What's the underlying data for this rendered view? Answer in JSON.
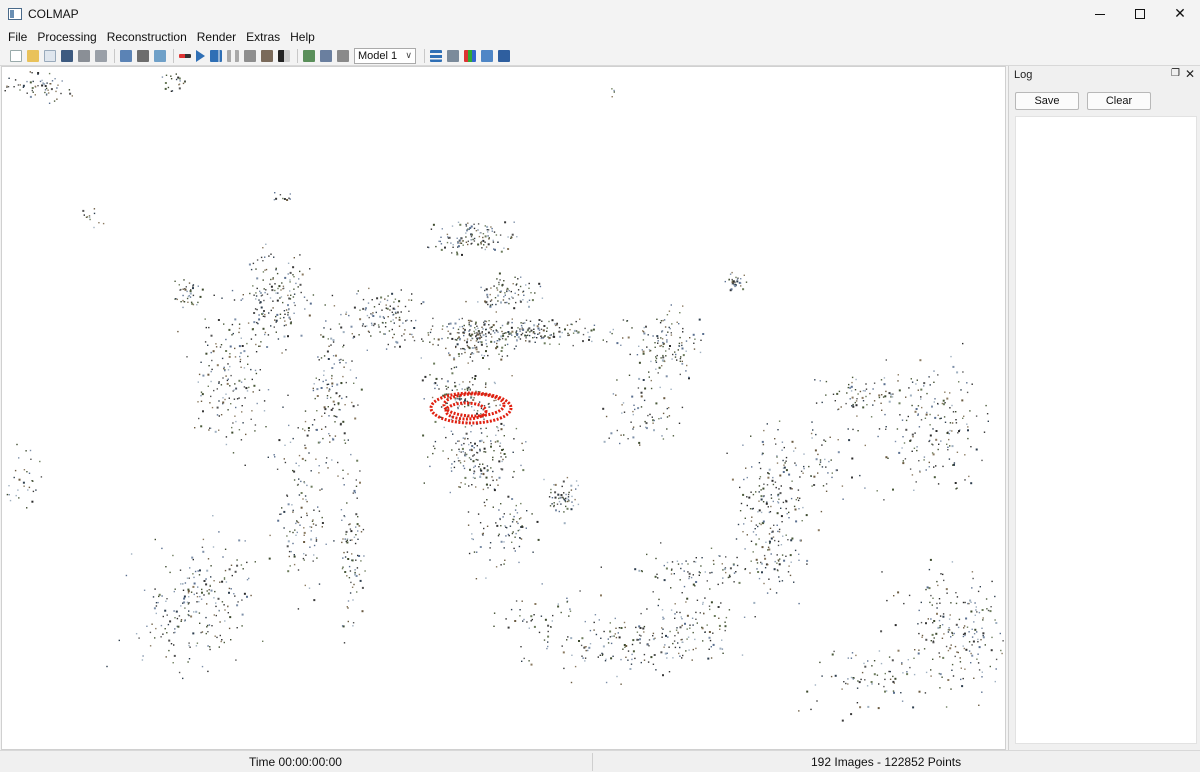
{
  "window": {
    "title": "COLMAP",
    "controls": [
      "minimize",
      "maximize",
      "close"
    ]
  },
  "menu": {
    "items": [
      "File",
      "Processing",
      "Reconstruction",
      "Render",
      "Extras",
      "Help"
    ]
  },
  "toolbar": {
    "icons": [
      "new-project-icon",
      "open-project-icon",
      "edit-project-icon",
      "save-project-icon",
      "import-model-icon",
      "export-model-icon",
      "feature-extraction-icon",
      "feature-matching-icon",
      "database-management-icon",
      "automatic-reconstruction-icon",
      "start-reconstruction-icon",
      "step-reconstruction-icon",
      "pause-reconstruction-icon",
      "reset-reconstruction-icon",
      "bundle-adjustment-icon",
      "dense-reconstruction-icon",
      "render-options-icon",
      "reset-view-icon",
      "grab-image-icon"
    ],
    "model_select": {
      "selected": "Model 1"
    },
    "right_icons": [
      "reconstruction-stats-icon",
      "match-matrix-icon",
      "show-log-icon",
      "grab-movie-icon",
      "undistort-icon"
    ]
  },
  "viewport": {
    "background": "#ffffff",
    "camera_color": "#e02010"
  },
  "log": {
    "title": "Log",
    "save_label": "Save",
    "clear_label": "Clear"
  },
  "status": {
    "time": "Time 00:00:00:00",
    "counts": "192 Images - 122852 Points"
  }
}
